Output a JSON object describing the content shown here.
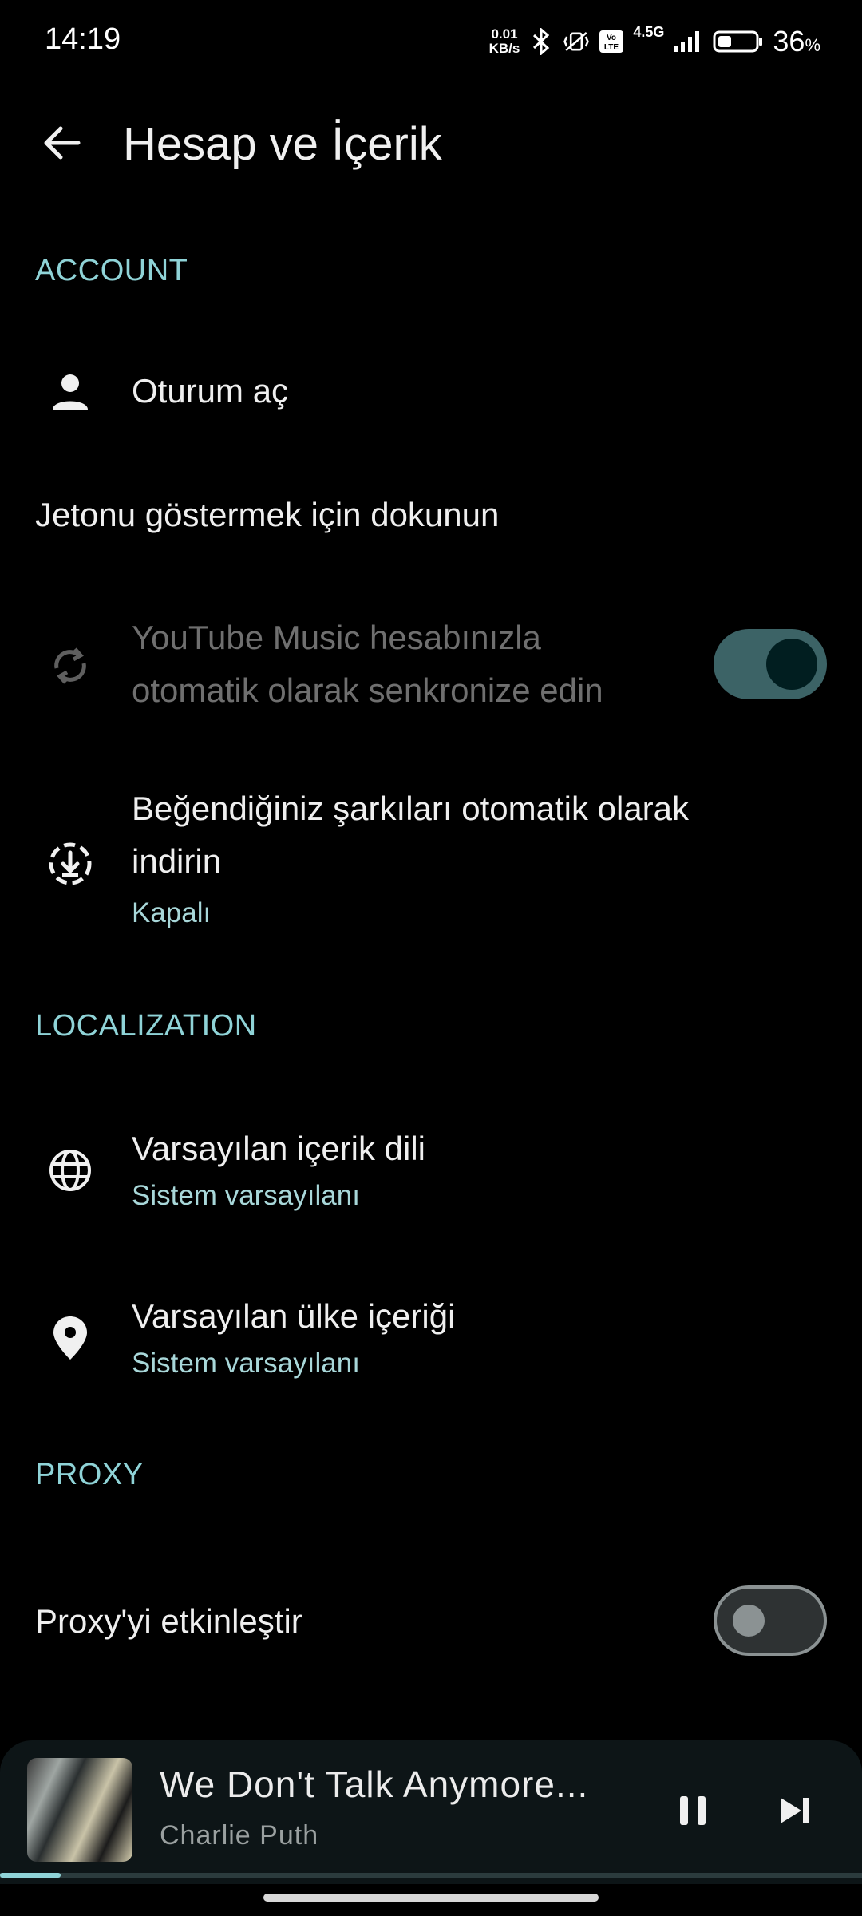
{
  "status_bar": {
    "time": "14:19",
    "net_speed_value": "0.01",
    "net_speed_unit": "KB/s",
    "network_label": "4.5G",
    "volte_label": "Vo LTE",
    "battery_percent": "36",
    "battery_unit": "%",
    "battery_level": 0.36
  },
  "header": {
    "title": "Hesap ve İçerik"
  },
  "sections": {
    "account": {
      "header": "ACCOUNT",
      "sign_in": {
        "title": "Oturum aç",
        "icon": "person-icon"
      },
      "token": {
        "title": "Jetonu göstermek için dokunun"
      },
      "sync": {
        "title_line1": "YouTube Music hesabınızla",
        "title_line2": "otomatik olarak senkronize edin",
        "icon": "sync-icon",
        "enabled": true,
        "disabled_row": true
      },
      "auto_download": {
        "title_line1": "Beğendiğiniz şarkıları otomatik olarak",
        "title_line2": "indirin",
        "subtitle": "Kapalı",
        "icon": "download-circle-icon"
      }
    },
    "localization": {
      "header": "LOCALIZATION",
      "content_language": {
        "title": "Varsayılan içerik dili",
        "subtitle": "Sistem varsayılanı",
        "icon": "globe-icon"
      },
      "content_country": {
        "title": "Varsayılan ülke içeriği",
        "subtitle": "Sistem varsayılanı",
        "icon": "location-pin-icon"
      }
    },
    "proxy": {
      "header": "PROXY",
      "enable_proxy": {
        "title": "Proxy'yi etkinleştir",
        "enabled": false
      }
    }
  },
  "mini_player": {
    "song_title": "We Don't Talk Anymore...",
    "artist": "Charlie Puth",
    "progress": 0.07
  },
  "colors": {
    "accent": "#8fd3d7",
    "background": "#000000",
    "toggle_on_track": "#3c6366",
    "player_background": "#0d1517"
  }
}
